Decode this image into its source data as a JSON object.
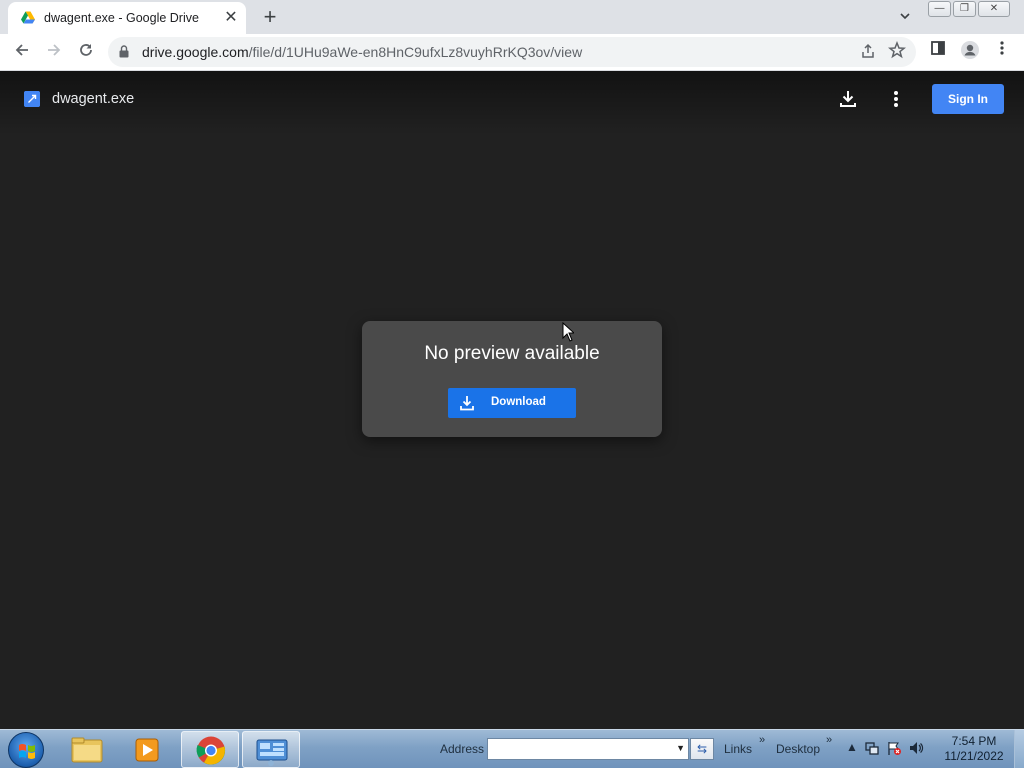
{
  "tab": {
    "title": "dwagent.exe - Google Drive",
    "close": "✕",
    "new_tab": "+"
  },
  "window_controls": {
    "minimize": "—",
    "restore": "❐",
    "close": "✕"
  },
  "address_bar": {
    "url_host": "drive.google.com",
    "url_path": "/file/d/1UHu9aWe-en8HnC9ufxLz8vuyhRrKQ3ov/view"
  },
  "viewer": {
    "file_name": "dwagent.exe",
    "sign_in_label": "Sign In",
    "card_title": "No preview available",
    "download_label": "Download"
  },
  "taskbar": {
    "address_label": "Address",
    "address_value": "",
    "links_label": "Links",
    "desktop_label": "Desktop",
    "time": "7:54 PM",
    "date": "11/21/2022"
  },
  "colors": {
    "viewer_bg": "#212121",
    "card_bg": "#4a4a4a",
    "accent": "#1a73e8",
    "sign_in": "#4285f4"
  }
}
